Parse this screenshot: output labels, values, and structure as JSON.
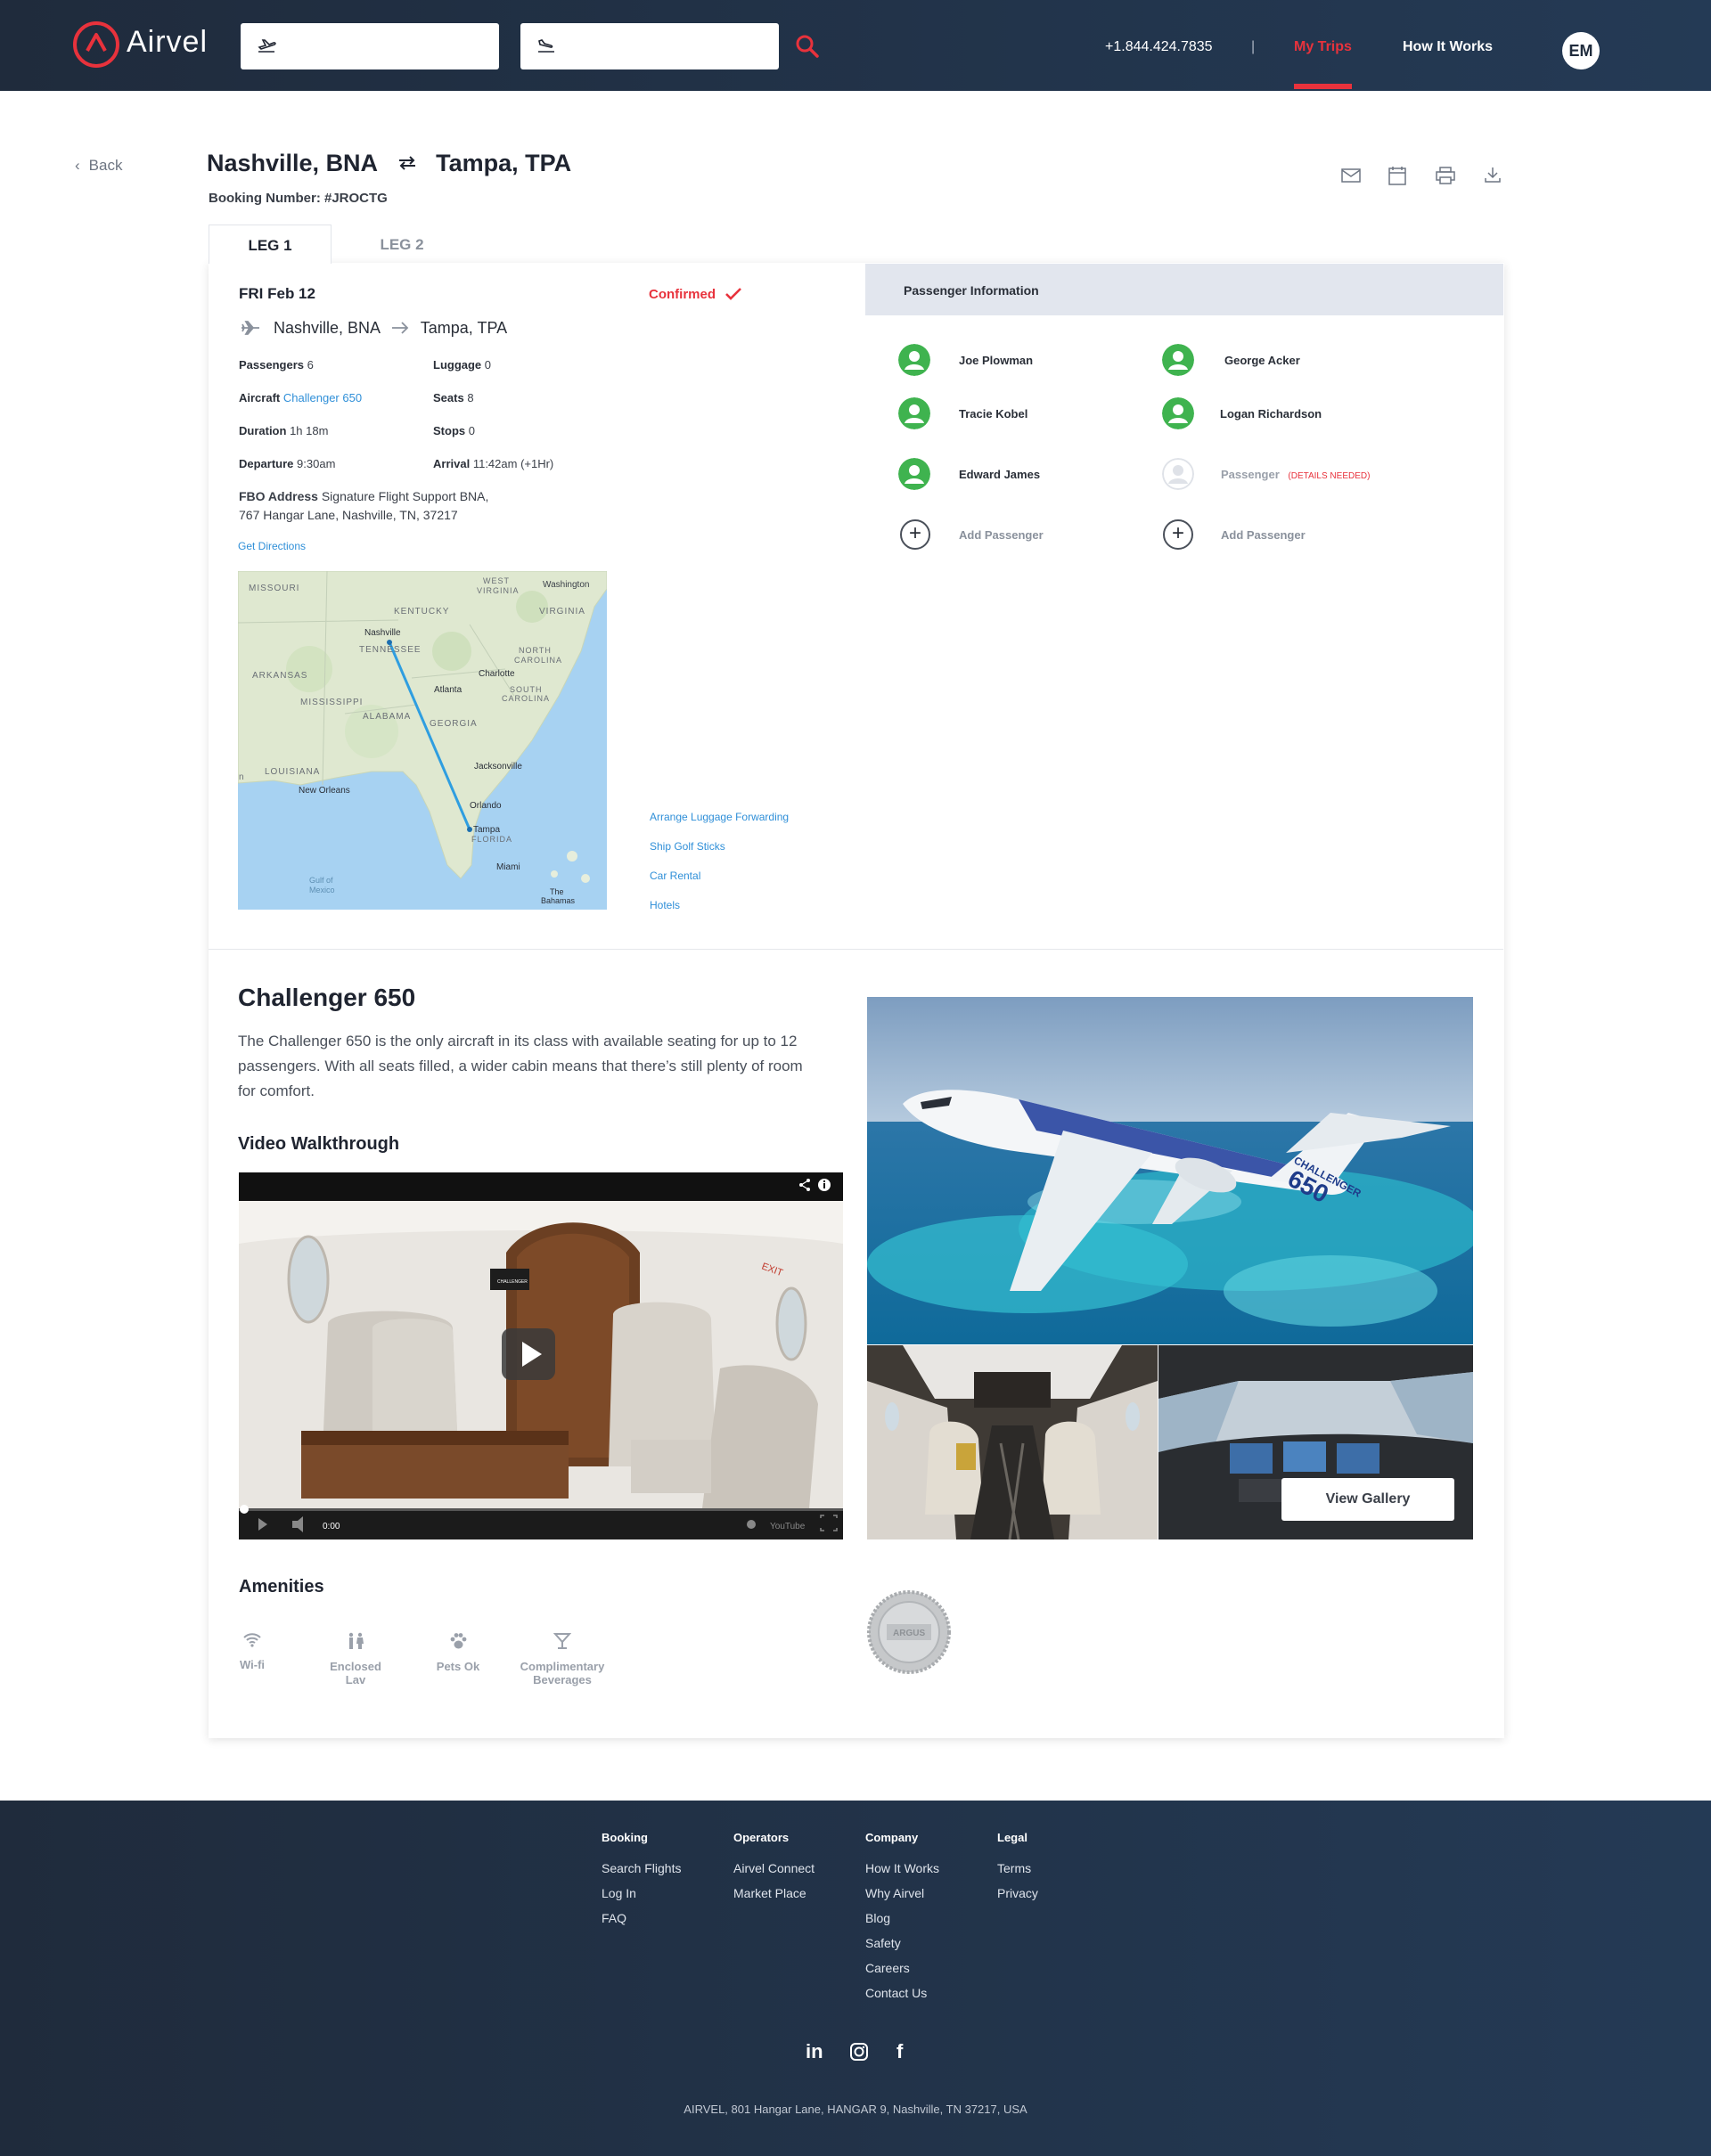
{
  "header": {
    "logo_text": "Airvel",
    "phone": "+1.844.424.7835",
    "separator": "|",
    "nav_my_trips": "My Trips",
    "nav_how_it_works": "How It Works",
    "avatar_initials": "EM"
  },
  "page": {
    "back": "Back",
    "origin": "Nashville, BNA",
    "destination": "Tampa, TPA",
    "booking_number": "Booking Number: #JROCTG",
    "tabs": [
      "LEG 1",
      "LEG 2"
    ]
  },
  "leg": {
    "date": "FRI Feb 12",
    "status": "Confirmed",
    "from": "Nashville, BNA",
    "to": "Tampa, TPA",
    "passengers_label": "Passengers",
    "passengers_value": "6",
    "luggage_label": "Luggage",
    "luggage_value": "0",
    "aircraft_label": "Aircraft",
    "aircraft_value": "Challenger 650",
    "seats_label": "Seats",
    "seats_value": "8",
    "duration_label": "Duration",
    "duration_value": "1h 18m",
    "stops_label": "Stops",
    "stops_value": "0",
    "departure_label": "Departure",
    "departure_value": "9:30am",
    "arrival_label": "Arrival",
    "arrival_value": "11:42am (+1Hr)",
    "fbo_label": "FBO Address",
    "fbo_line1": "Signature Flight Support BNA,",
    "fbo_line2": "767 Hangar Lane, Nashville, TN, 37217",
    "directions": "Get Directions",
    "quick_links": [
      "Arrange Luggage Forwarding",
      "Ship Golf Sticks",
      "Car Rental",
      "Hotels"
    ]
  },
  "map": {
    "labels": [
      "MISSOURI",
      "WEST",
      "VIRGINIA",
      "Washington",
      "KENTUCKY",
      "VIRGINIA",
      "Nashville",
      "TENNESSEE",
      "NORTH",
      "CAROLINA",
      "ARKANSAS",
      "Charlotte",
      "Atlanta",
      "SOUTH",
      "CAROLINA",
      "MISSISSIPPI",
      "ALABAMA",
      "GEORGIA",
      "Jacksonville",
      "LOUISIANA",
      "New Orleans",
      "Orlando",
      "Tampa",
      "FLORIDA",
      "Gulf of",
      "Mexico",
      "Miami",
      "The",
      "Bahamas",
      "n"
    ]
  },
  "passengers": {
    "heading": "Passenger Information",
    "names": [
      "Joe Plowman",
      "George Acker",
      "Tracie Kobel",
      "Logan Richardson",
      "Edward James"
    ],
    "pending_label": "Passenger",
    "pending_note": "(DETAILS NEEDED)",
    "add_label": "Add Passenger"
  },
  "aircraft": {
    "title": "Challenger 650",
    "description": "The Challenger 650 is the only aircraft in its class with available seating for up to 12 passengers. With all seats filled, a wider cabin means that there’s still plenty of room for comfort.",
    "video_heading": "Video Walkthrough",
    "video_time": "0:00",
    "video_logo": "YouTube",
    "cabin_sign": "EXIT",
    "cabin_screen": "CHALLENGER",
    "tail_text": "CHALLENGER",
    "tail_number": "650",
    "view_gallery": "View Gallery",
    "amenities_heading": "Amenities",
    "amenities": [
      "Wi-fi",
      "Enclosed",
      "Lav",
      "Pets Ok",
      "Complimentary",
      "Beverages"
    ],
    "seal_text": "ARGUS"
  },
  "footer": {
    "columns": [
      {
        "heading": "Booking",
        "links": [
          "Search Flights",
          "Log In",
          "FAQ"
        ]
      },
      {
        "heading": "Operators",
        "links": [
          "Airvel Connect",
          "Market Place"
        ]
      },
      {
        "heading": "Company",
        "links": [
          "How It Works",
          "Why Airvel",
          "Blog",
          "Safety",
          "Careers",
          "Contact Us"
        ]
      },
      {
        "heading": "Legal",
        "links": [
          "Terms",
          "Privacy"
        ]
      }
    ],
    "social_in": "in",
    "social_fb": "f",
    "address": "AIRVEL, 801 Hangar Lane, HANGAR 9, Nashville, TN 37217, USA"
  },
  "colors": {
    "brand_red": "#e8323c",
    "header_navy": "#1f2b3c",
    "link_blue": "#2f8fd8",
    "passenger_green": "#3fb34f"
  },
  "icons": [
    "takeoff-icon",
    "landing-icon",
    "search-icon",
    "mail-icon",
    "calendar-icon",
    "print-icon",
    "download-icon",
    "plane-icon",
    "arrow-right-icon",
    "swap-icon",
    "checkmark-icon",
    "user-icon",
    "plus-icon",
    "play-icon",
    "share-icon",
    "info-icon",
    "wifi-icon",
    "restroom-icon",
    "paw-icon",
    "cocktail-icon",
    "linkedin-icon",
    "instagram-icon",
    "facebook-icon"
  ]
}
